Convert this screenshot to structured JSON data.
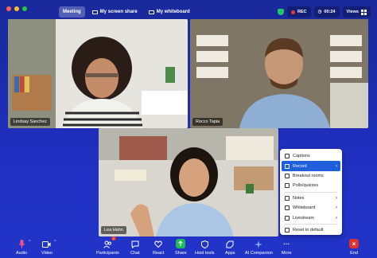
{
  "window": {
    "dots": [
      "#ff5f57",
      "#febc2e",
      "#28c840"
    ]
  },
  "tabs": [
    {
      "label": "Meeting",
      "active": true
    },
    {
      "label": "My screen share",
      "active": false
    },
    {
      "label": "My whiteboard",
      "active": false
    }
  ],
  "status": {
    "rec_label": "REC",
    "timer": "00:24",
    "views_label": "Views"
  },
  "participants": [
    {
      "name": "Lindsay Sanchez"
    },
    {
      "name": "Rocco Tapia"
    },
    {
      "name": "Lea Hahn"
    }
  ],
  "menu": {
    "items": [
      {
        "label": "Captions",
        "submenu": false,
        "selected": false
      },
      {
        "label": "Record",
        "submenu": true,
        "selected": true
      },
      {
        "label": "Breakout rooms",
        "submenu": false,
        "selected": false
      },
      {
        "label": "Polls/quizzes",
        "submenu": false,
        "selected": false
      },
      {
        "label": "Notes",
        "submenu": true,
        "selected": false
      },
      {
        "label": "Whiteboard",
        "submenu": true,
        "selected": false
      },
      {
        "label": "Livestream",
        "submenu": true,
        "selected": false
      },
      {
        "label": "Reset to default",
        "submenu": false,
        "selected": false
      }
    ]
  },
  "toolbar": {
    "audio": "Audio",
    "video": "Video",
    "participants": "Participants",
    "participants_count": "2",
    "chat": "Chat",
    "react": "React",
    "share": "Share",
    "host_tools": "Host tools",
    "apps": "Apps",
    "ai_companion": "AI Companion",
    "more": "More",
    "end": "End"
  },
  "colors": {
    "background": "#1b2cae",
    "menu_selected": "#1f5fdc",
    "end_button": "#e0322d",
    "share_button": "#22b855"
  }
}
